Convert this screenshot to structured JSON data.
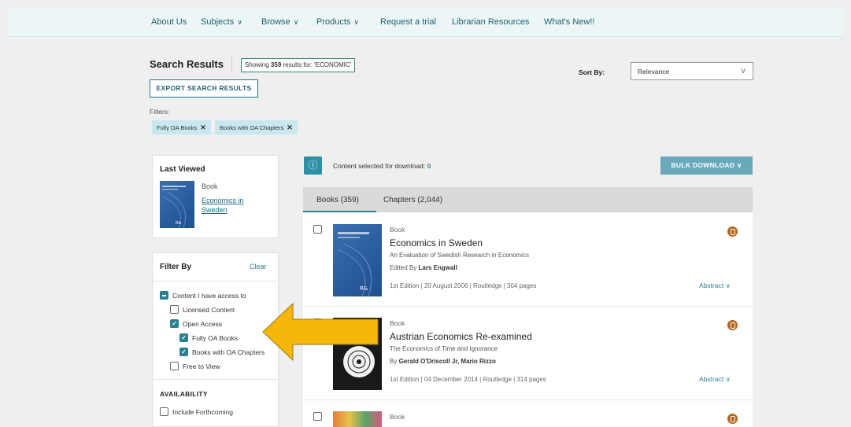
{
  "nav": {
    "items": [
      {
        "label": "About Us",
        "chevron": false
      },
      {
        "label": "Subjects",
        "chevron": true
      },
      {
        "label": "Browse",
        "chevron": true
      },
      {
        "label": "Products",
        "chevron": true
      },
      {
        "label": "Request a trial",
        "chevron": false
      },
      {
        "label": "Librarian Resources",
        "chevron": false
      },
      {
        "label": "What's New!!",
        "chevron": false
      }
    ]
  },
  "search": {
    "title": "Search Results",
    "showing_prefix": "Showing",
    "count": "359",
    "showing_suffix": "results for: 'ECONOMIC'",
    "export_label": "EXPORT SEARCH RESULTS",
    "filters_label": "Filters:",
    "chips": [
      "Fully OA Books",
      "Books with OA Chapters"
    ],
    "sort_label": "Sort By:",
    "sort_value": "Relevance"
  },
  "last_viewed": {
    "title": "Last Viewed",
    "type": "Book",
    "link": "Economics in Sweden"
  },
  "filter_by": {
    "title": "Filter By",
    "clear": "Clear",
    "options": [
      {
        "label": "Content I have access to",
        "state": "partial",
        "level": 0
      },
      {
        "label": "Licensed Content",
        "state": "unchecked",
        "level": 1
      },
      {
        "label": "Open Access",
        "state": "checked",
        "level": 1
      },
      {
        "label": "Fully OA Books",
        "state": "checked",
        "level": 2
      },
      {
        "label": "Books with OA Chapters",
        "state": "checked",
        "level": 2
      },
      {
        "label": "Free to View",
        "state": "unchecked",
        "level": 1
      }
    ],
    "availability_title": "AVAILABILITY",
    "include_forthcoming": "Include Forthcoming"
  },
  "info": {
    "icon": "info-icon",
    "text": "Content selected for download:",
    "count": "0"
  },
  "bulk_download": "BULK DOWNLOAD",
  "tabs": [
    {
      "label": "Books (359)",
      "active": true
    },
    {
      "label": "Chapters (2,044)",
      "active": false
    }
  ],
  "results": [
    {
      "type": "Book",
      "title": "Economics in Sweden",
      "subtitle": "An Evaluation of Swedish Research in Economics",
      "author_prefix": "Edited By",
      "authors": "Lars Engwall",
      "meta": "1st Edition | 20 August 2006 | Routledge | 304 pages",
      "abstract": "Abstract",
      "cover_color": "#3a6fb1"
    },
    {
      "type": "Book",
      "title": "Austrian Economics Re-examined",
      "subtitle": "The Economics of Time and Ignorance",
      "author_prefix": "By",
      "authors": "Gerald O'Driscoll Jr, Mario Rizzo",
      "meta": "1st Edition | 04 December 2014 | Routledge | 314 pages",
      "abstract": "Abstract",
      "cover_color": "#1a1a1a"
    },
    {
      "type": "Book",
      "cover_color": "#e0803a"
    }
  ],
  "colors": {
    "accent": "#2b7f94",
    "arrow": "#f6b60a",
    "oa_badge": "#b5651d"
  }
}
